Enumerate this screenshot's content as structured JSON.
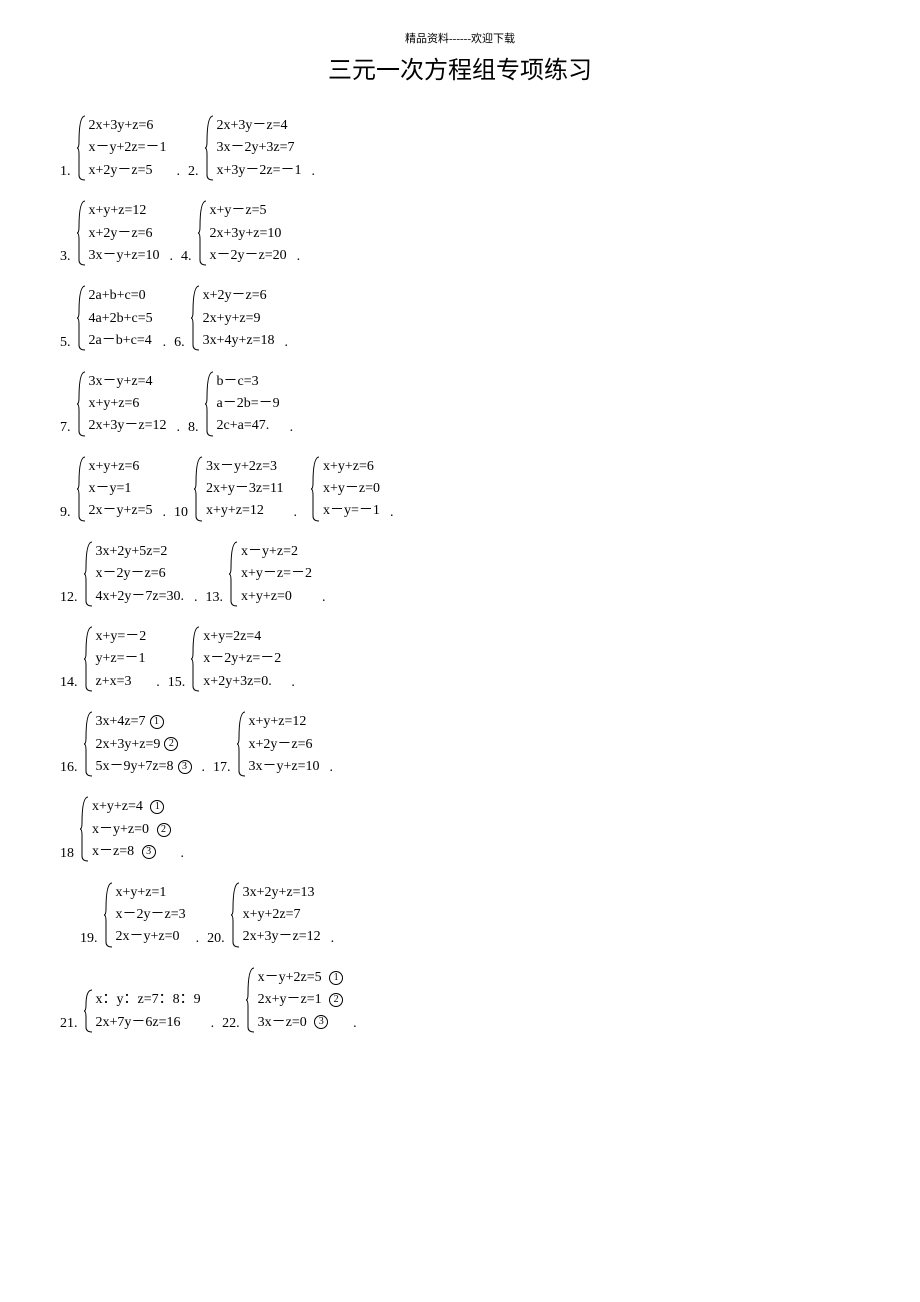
{
  "header_small": "精品资料------欢迎下载",
  "title": "三元一次方程组专项练习",
  "problems": [
    {
      "n": "1.",
      "eqs": [
        "2x+3y+z=6",
        "x－y+2z=－1",
        "x+2y－z=5"
      ]
    },
    {
      "n": "2.",
      "eqs": [
        "2x+3y－z=4",
        "3x－2y+3z=7",
        "x+3y－2z=－1"
      ]
    },
    {
      "n": "3.",
      "eqs": [
        "x+y+z=12",
        "x+2y－z=6",
        "3x－y+z=10"
      ]
    },
    {
      "n": "4.",
      "eqs": [
        "x+y－z=5",
        "2x+3y+z=10",
        "x－2y－z=20"
      ]
    },
    {
      "n": "5.",
      "eqs": [
        "2a+b+c=0",
        "4a+2b+c=5",
        "2a－b+c=4"
      ]
    },
    {
      "n": "6.",
      "eqs": [
        "x+2y－z=6",
        "2x+y+z=9",
        "3x+4y+z=18"
      ]
    },
    {
      "n": "7.",
      "eqs": [
        "3x－y+z=4",
        "x+y+z=6",
        "2x+3y－z=12"
      ]
    },
    {
      "n": "8.",
      "eqs": [
        "b－c=3",
        "a－2b=－9",
        "2c+a=47."
      ]
    },
    {
      "n": "9.",
      "eqs": [
        "x+y+z=6",
        "x－y=1",
        "2x－y+z=5"
      ]
    },
    {
      "n": "10",
      "eqs": [
        "3x－y+2z=3",
        "2x+y－3z=11",
        "x+y+z=12"
      ]
    },
    {
      "n": "",
      "eqs": [
        "x+y+z=6",
        "x+y－z=0",
        "x－y=－1"
      ]
    },
    {
      "n": "12.",
      "eqs": [
        "3x+2y+5z=2",
        "x－2y－z=6",
        "4x+2y－7z=30."
      ]
    },
    {
      "n": "13.",
      "eqs": [
        "x－y+z=2",
        "x+y－z=－2",
        "x+y+z=0"
      ]
    },
    {
      "n": "14.",
      "eqs": [
        "x+y=－2",
        "y+z=－1",
        "z+x=3"
      ]
    },
    {
      "n": "15.",
      "eqs": [
        "x+y=2z=4",
        "x－2y+z=－2",
        "x+2y+3z=0."
      ]
    },
    {
      "n": "16.",
      "eqs": [
        "3x+4z=7①",
        "2x+3y+z=9②",
        "5x－9y+7z=8③"
      ]
    },
    {
      "n": "17.",
      "eqs": [
        "x+y+z=12",
        "x+2y－z=6",
        "3x－y+z=10"
      ]
    },
    {
      "n": "18",
      "eqs": [
        "x+y+z=4   ①",
        "x－y+z=0   ②",
        "x－z=8         ③"
      ]
    },
    {
      "n": "19.",
      "eqs": [
        "x+y+z=1",
        "x－2y－z=3",
        "2x－y+z=0"
      ]
    },
    {
      "n": "20.",
      "eqs": [
        "3x+2y+z=13",
        "x+y+2z=7",
        "2x+3y－z=12"
      ]
    },
    {
      "n": "21.",
      "eqs": [
        "x：y：z=7：8：9",
        "2x+7y－6z=16"
      ]
    },
    {
      "n": "22.",
      "eqs": [
        "x－y+2z=5 ①",
        "2x+y－z=1 ②",
        "3x－z=0    ③"
      ]
    }
  ],
  "layout": [
    [
      0,
      1
    ],
    [
      2,
      3
    ],
    [
      4,
      5
    ],
    [
      6,
      7
    ],
    [
      8,
      9,
      10
    ],
    [
      11,
      12
    ],
    [
      13,
      14
    ],
    [
      15,
      16
    ],
    [
      17
    ],
    [
      18,
      19
    ],
    [
      20,
      21
    ]
  ]
}
